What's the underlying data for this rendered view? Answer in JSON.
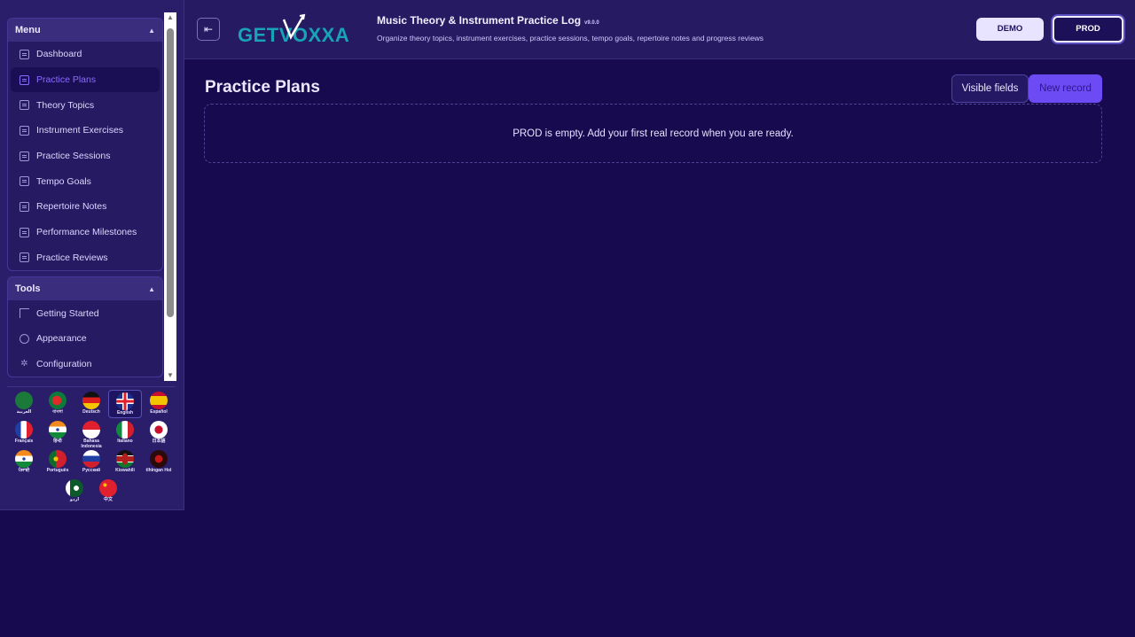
{
  "sidebar": {
    "menu_title": "Menu",
    "menu_items": [
      {
        "label": "Dashboard",
        "active": false
      },
      {
        "label": "Practice Plans",
        "active": true
      },
      {
        "label": "Theory Topics",
        "active": false
      },
      {
        "label": "Instrument Exercises",
        "active": false
      },
      {
        "label": "Practice Sessions",
        "active": false
      },
      {
        "label": "Tempo Goals",
        "active": false
      },
      {
        "label": "Repertoire Notes",
        "active": false
      },
      {
        "label": "Performance Milestones",
        "active": false
      },
      {
        "label": "Practice Reviews",
        "active": false
      }
    ],
    "tools_title": "Tools",
    "tools_items": [
      {
        "label": "Getting Started",
        "icon": "flag-icon"
      },
      {
        "label": "Appearance",
        "icon": "palette-icon"
      },
      {
        "label": "Configuration",
        "icon": "gear-icon"
      }
    ],
    "languages": [
      {
        "name": "العربية",
        "icon": "flag-saudi-arabia-icon"
      },
      {
        "name": "বাংলা",
        "icon": "flag-bangladesh-icon"
      },
      {
        "name": "Deutsch",
        "icon": "flag-germany-icon"
      },
      {
        "name": "English",
        "icon": "flag-uk-icon",
        "selected": true
      },
      {
        "name": "Español",
        "icon": "flag-spain-icon"
      },
      {
        "name": "Français",
        "icon": "flag-france-icon"
      },
      {
        "name": "हिन्दी",
        "icon": "flag-india-icon"
      },
      {
        "name": "Bahasa Indonesia",
        "icon": "flag-indonesia-icon"
      },
      {
        "name": "Italiano",
        "icon": "flag-italy-icon"
      },
      {
        "name": "日本語",
        "icon": "flag-japan-icon"
      },
      {
        "name": "ਪੰਜਾਬੀ",
        "icon": "flag-india-icon"
      },
      {
        "name": "Português",
        "icon": "flag-portugal-icon"
      },
      {
        "name": "Русский",
        "icon": "flag-russia-icon"
      },
      {
        "name": "Kiswahili",
        "icon": "flag-kenya-icon"
      },
      {
        "name": "tlhIngan Hol",
        "icon": "flag-klingon-icon"
      },
      {
        "name": "اردو",
        "icon": "flag-pakistan-icon"
      },
      {
        "name": "中文",
        "icon": "flag-china-icon"
      }
    ]
  },
  "header": {
    "logo_text": "GETVOXXA",
    "title": "Music Theory & Instrument Practice Log",
    "version": "v9.0.0",
    "subtitle": "Organize theory topics, instrument exercises, practice sessions, tempo goals, repertoire notes and progress reviews",
    "demo_label": "DEMO",
    "prod_label": "PROD"
  },
  "main": {
    "page_title": "Practice Plans",
    "visible_fields_label": "Visible fields",
    "new_record_label": "New record",
    "empty_message": "PROD is empty. Add your first real record when you are ready."
  },
  "colors": {
    "background": "#170a4e",
    "sidebar": "#2a1d6a",
    "accent": "#6c4bf5",
    "active_text": "#8b6bff"
  }
}
